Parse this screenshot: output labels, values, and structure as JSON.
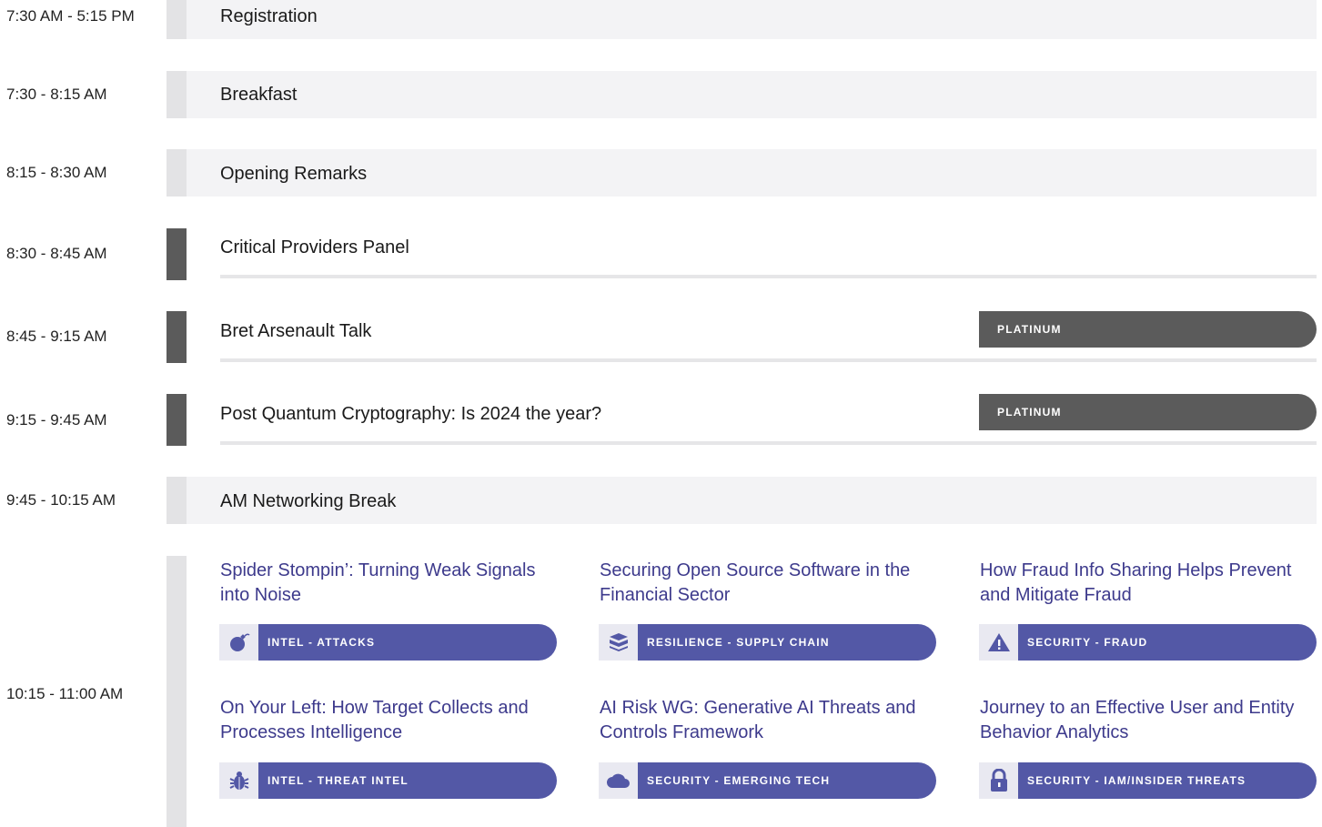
{
  "schedule": {
    "rows": [
      {
        "time": "7:30 AM - 5:15 PM",
        "title": "Registration"
      },
      {
        "time": "7:30 - 8:15 AM",
        "title": "Breakfast"
      },
      {
        "time": "8:15 - 8:30 AM",
        "title": "Opening Remarks"
      },
      {
        "time": "8:30 - 8:45 AM",
        "title": "Critical Providers Panel"
      },
      {
        "time": "8:45 - 9:15 AM",
        "title": "Bret Arsenault Talk",
        "badge": "PLATINUM"
      },
      {
        "time": "9:15 - 9:45 AM",
        "title": "Post Quantum Cryptography: Is 2024 the year?",
        "badge": "PLATINUM"
      },
      {
        "time": "9:45 - 10:15 AM",
        "title": "AM Networking Break"
      }
    ],
    "breakout": {
      "time": "10:15 - 11:00 AM",
      "sessions": [
        {
          "title": "Spider Stompin’: Turning Weak Signals into Noise",
          "tag": "INTEL - ATTACKS",
          "icon": "bomb-icon"
        },
        {
          "title": "Securing Open Source Software in the Financial Sector",
          "tag": "RESILIENCE - SUPPLY CHAIN",
          "icon": "boxes-icon"
        },
        {
          "title": "How Fraud Info Sharing Helps Prevent and Mitigate Fraud",
          "tag": "SECURITY - FRAUD",
          "icon": "warning-icon"
        },
        {
          "title": "On Your Left: How Target Collects and Processes Intelligence",
          "tag": "INTEL - THREAT INTEL",
          "icon": "bug-icon"
        },
        {
          "title": "AI Risk WG: Generative AI Threats and Controls Framework",
          "tag": "SECURITY - EMERGING TECH",
          "icon": "cloud-icon"
        },
        {
          "title": "Journey to an Effective User and Entity Behavior Analytics",
          "tag": "SECURITY - IAM/INSIDER THREATS",
          "icon": "lock-icon"
        }
      ]
    }
  },
  "colors": {
    "track_purple": "#5358a6",
    "platinum_gray": "#5b5b5b",
    "block_bg": "#f3f3f5"
  }
}
